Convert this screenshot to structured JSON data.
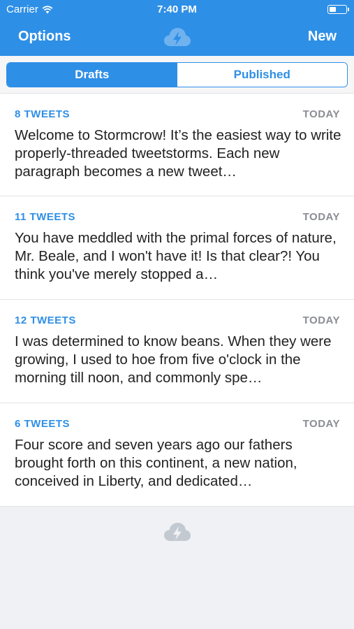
{
  "status_bar": {
    "carrier": "Carrier",
    "time": "7:40 PM",
    "wifi_icon": "wifi-icon",
    "battery_icon": "battery-icon"
  },
  "nav": {
    "left_label": "Options",
    "right_label": "New",
    "logo_icon": "cloud-lightning-icon"
  },
  "segments": {
    "drafts_label": "Drafts",
    "published_label": "Published",
    "selected": "Drafts"
  },
  "drafts": [
    {
      "count": "8 TWEETS",
      "date": "TODAY",
      "preview": "Welcome to Stormcrow! It’s the easiest way to write properly-threaded tweetstorms. Each new paragraph becomes a new tweet…"
    },
    {
      "count": "11 TWEETS",
      "date": "TODAY",
      "preview": "You have meddled with the primal forces of nature, Mr. Beale, and I won't have it! Is that clear?! You think you've merely stopped a…"
    },
    {
      "count": "12 TWEETS",
      "date": "TODAY",
      "preview": "I was determined to know beans. When they were growing, I used to hoe from five o'clock in the morning till noon, and commonly spe…"
    },
    {
      "count": "6 TWEETS",
      "date": "TODAY",
      "preview": "Four score and seven years ago our fathers brought forth on this continent, a new nation, conceived in Liberty, and dedicated…"
    }
  ],
  "colors": {
    "accent": "#2e8fe6",
    "date_gray": "#8a8d92",
    "background": "#eff1f4"
  }
}
